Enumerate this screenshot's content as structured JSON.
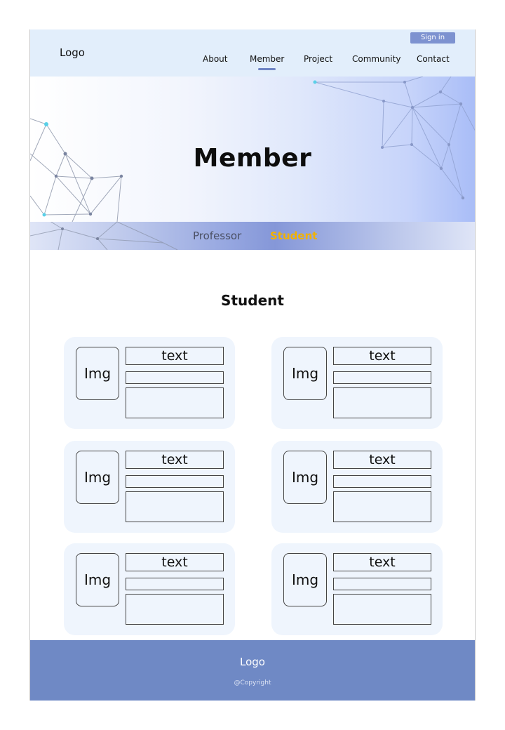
{
  "header": {
    "logo": "Logo",
    "sign_in": "Sign in",
    "nav": [
      {
        "label": "About",
        "active": false
      },
      {
        "label": "Member",
        "active": true
      },
      {
        "label": "Project",
        "active": false
      },
      {
        "label": "Community",
        "active": false
      },
      {
        "label": "Contact",
        "active": false
      }
    ]
  },
  "hero": {
    "title": "Member"
  },
  "subnav": {
    "items": [
      {
        "label": "Professor",
        "active": false
      },
      {
        "label": "Student",
        "active": true
      }
    ]
  },
  "section": {
    "title": "Student"
  },
  "cards": [
    {
      "img_label": "Img",
      "text": "text"
    },
    {
      "img_label": "Img",
      "text": "text"
    },
    {
      "img_label": "Img",
      "text": "text"
    },
    {
      "img_label": "Img",
      "text": "text"
    },
    {
      "img_label": "Img",
      "text": "text"
    },
    {
      "img_label": "Img",
      "text": "text"
    }
  ],
  "footer": {
    "logo": "Logo",
    "copyright": "@Copyright"
  },
  "colors": {
    "header_bg": "#e2eefb",
    "accent": "#6e84c4",
    "sign_in_bg": "#7d92d0",
    "active_subnav": "#f2b200",
    "card_bg": "#eff5fd",
    "footer_bg": "#6f89c5"
  }
}
